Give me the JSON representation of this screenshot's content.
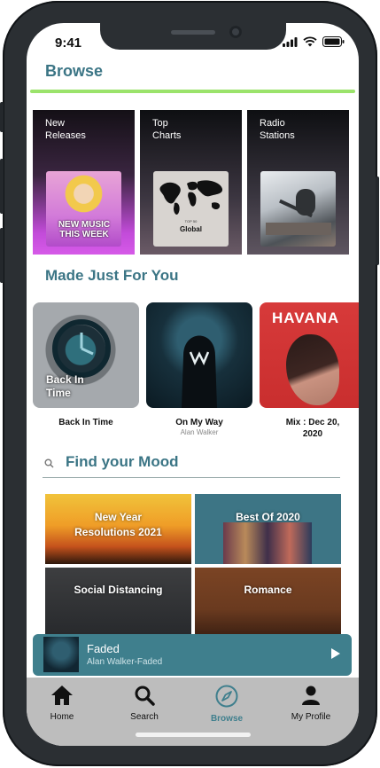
{
  "status": {
    "time": "9:41"
  },
  "header": {
    "title": "Browse"
  },
  "browse_cards": [
    {
      "label": "New\nReleases",
      "art_text": "NEW MUSIC THIS WEEK"
    },
    {
      "label": "Top\nCharts",
      "art_text": "Global",
      "art_sub": "TOP 50"
    },
    {
      "label": "Radio\nStations"
    }
  ],
  "made_for_you": {
    "title": "Made Just For You",
    "items": [
      {
        "name": "Back In Time",
        "art_text": "Back In\nTime",
        "artist": ""
      },
      {
        "name": "On My Way",
        "artist": "Alan Walker"
      },
      {
        "name": "Mix : Dec 20,\n2020",
        "artist": "",
        "art_text": "HAVANA"
      }
    ]
  },
  "mood": {
    "title": "Find your Mood",
    "tiles": [
      {
        "label": "New Year\nResolutions 2021"
      },
      {
        "label": "Best Of 2020"
      },
      {
        "label": "Social Distancing"
      },
      {
        "label": "Romance"
      }
    ]
  },
  "now_playing": {
    "title": "Faded",
    "subtitle": "Alan Walker-Faded"
  },
  "tabs": [
    {
      "label": "Home",
      "icon": "home-icon"
    },
    {
      "label": "Search",
      "icon": "search-icon"
    },
    {
      "label": "Browse",
      "icon": "compass-icon",
      "active": true
    },
    {
      "label": "My Profile",
      "icon": "profile-icon"
    }
  ],
  "colors": {
    "accent": "#3b7585",
    "rule": "#9be36b",
    "tabbar": "#bdbdbd"
  }
}
